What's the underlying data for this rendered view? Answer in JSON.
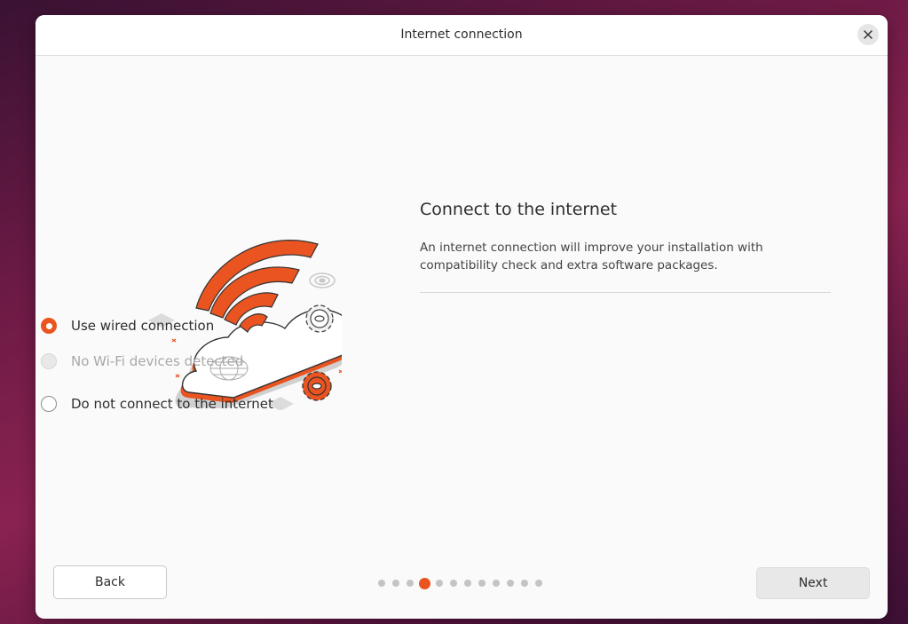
{
  "dialog": {
    "title": "Internet connection"
  },
  "main": {
    "heading": "Connect to the internet",
    "description": "An internet connection will improve your installation with compatibility check and extra software packages.",
    "options": [
      {
        "label": "Use wired connection",
        "state": "selected"
      },
      {
        "label": "No Wi-Fi devices detected",
        "state": "disabled"
      },
      {
        "label": "Do not connect to the internet",
        "state": "unselected"
      }
    ]
  },
  "footer": {
    "back_label": "Back",
    "next_label": "Next",
    "progress": {
      "total_steps": 12,
      "current_step": 4
    }
  },
  "colors": {
    "accent": "#e95420",
    "disabled": "#a8a8a8"
  },
  "icons": [
    "close-icon",
    "wifi-cloud-illustration"
  ]
}
